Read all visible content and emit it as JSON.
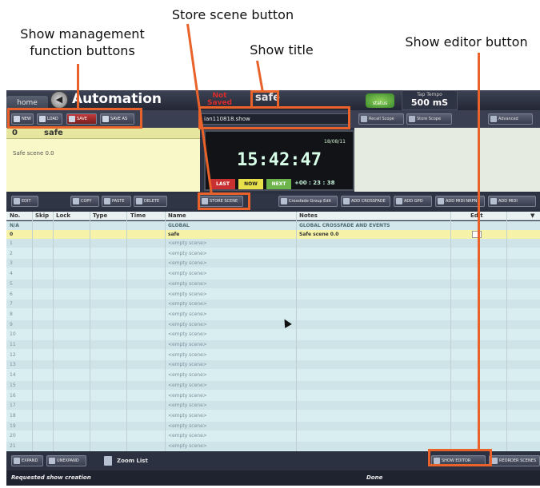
{
  "annotations": {
    "mgmt": "Show management\nfunction buttons",
    "store": "Store scene button",
    "title": "Show title",
    "editor": "Show editor button"
  },
  "colors": {
    "callout": "#e8622a",
    "selected_row": "#f6f3a8",
    "save_red": "#c23a3a",
    "status_green": "#6db54a"
  },
  "app": {
    "home_tab": "home",
    "title": "Automation",
    "not_saved": "Not Saved",
    "show_name": "safe",
    "status_label": "status",
    "tap_tempo_label": "Tap Tempo",
    "tap_tempo_value": "500 mS"
  },
  "show_mgmt": {
    "new": "NEW",
    "load": "LOAD",
    "save": "SAVE",
    "save_as": "SAVE AS"
  },
  "show_file": "ian110818.show",
  "scene_buttons": {
    "recall": "Recall Scope",
    "store": "Store Scope",
    "advanced": "Advanced"
  },
  "current_scene": {
    "number": "0",
    "name": "safe",
    "notes": "Safe scene 0.0"
  },
  "clock": {
    "date": "18/08/11",
    "time": "15:42:47",
    "last": "LAST",
    "now": "NOW",
    "next": "NEXT",
    "relative": "+00 : 23 : 38"
  },
  "toolbar": {
    "edit": "EDIT",
    "copy": "COPY",
    "paste": "PASTE",
    "delete": "DELETE",
    "store_scene": "STORE SCENE",
    "crossfade_edit": "Crossfade Group Edit",
    "add_crossfade": "ADD CROSSFADE",
    "add_gpo": "ADD GPO",
    "add_midi": "ADD MIDI NRPN",
    "add_midi2": "ADD MIDI"
  },
  "table": {
    "headers": {
      "no": "No.",
      "skip": "Skip",
      "lock": "Lock",
      "type": "Type",
      "time": "Time",
      "name": "Name",
      "notes": "Notes",
      "edit": "Edit"
    },
    "global_row": {
      "no": "N/A",
      "name": "GLOBAL",
      "notes": "GLOBAL CROSSFADE AND EVENTS"
    },
    "selected_row": {
      "no": "0",
      "name": "safe",
      "notes": "Safe scene 0.0"
    },
    "empty_name": "<empty scene>",
    "empty_numbers": [
      "1",
      "2",
      "3",
      "4",
      "5",
      "6",
      "7",
      "8",
      "9",
      "10",
      "11",
      "12",
      "13",
      "14",
      "15",
      "16",
      "17",
      "18",
      "19",
      "20",
      "21"
    ]
  },
  "bottom": {
    "expand": "EXPAND",
    "unexpand": "UNEXPAND",
    "zoom_list": "Zoom List",
    "show_editor": "SHOW EDITOR",
    "reorder": "REORDER SCENES"
  },
  "status": {
    "message": "Requested show creation",
    "state": "Done"
  }
}
